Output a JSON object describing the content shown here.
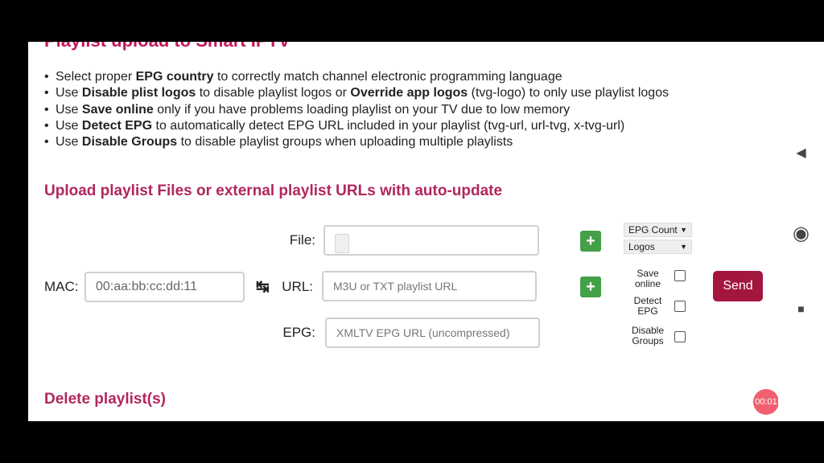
{
  "title": "Playlist upload to Smart IPTV",
  "tips": [
    [
      {
        "t": "Select proper "
      },
      {
        "t": "EPG country",
        "b": true
      },
      {
        "t": " to correctly match channel electronic programming language"
      }
    ],
    [
      {
        "t": "Use "
      },
      {
        "t": "Disable plist logos",
        "b": true
      },
      {
        "t": " to disable playlist logos or "
      },
      {
        "t": "Override app logos",
        "b": true
      },
      {
        "t": " (tvg-logo) to only use playlist logos"
      }
    ],
    [
      {
        "t": "Use "
      },
      {
        "t": "Save online",
        "b": true
      },
      {
        "t": " only if you have problems loading playlist on your TV due to low memory"
      }
    ],
    [
      {
        "t": "Use "
      },
      {
        "t": "Detect EPG",
        "b": true
      },
      {
        "t": " to automatically detect EPG URL included in your playlist (tvg-url, url-tvg, x-tvg-url)"
      }
    ],
    [
      {
        "t": "Use "
      },
      {
        "t": "Disable Groups",
        "b": true
      },
      {
        "t": " to disable playlist groups when uploading multiple playlists"
      }
    ]
  ],
  "upload_title": "Upload playlist Files or external playlist URLs with auto-update",
  "form": {
    "mac_label": "MAC:",
    "mac_value": "00:aa:bb:cc:dd:11",
    "swap_icon": "↹",
    "file_label": "File:",
    "url_label": "URL:",
    "url_placeholder": "M3U or TXT playlist URL",
    "epg_label": "EPG:",
    "epg_placeholder": "XMLTV EPG URL (uncompressed)",
    "plus": "+",
    "selects": {
      "epg_count": "EPG Count",
      "logos": "Logos",
      "arrow": "▼"
    },
    "checks": {
      "save_online": "Save\nonline",
      "detect_epg": "Detect\nEPG",
      "disable_groups": "Disable\nGroups"
    },
    "send": "Send"
  },
  "delete_title": "Delete playlist(s)",
  "recording": "00:01",
  "nav": {
    "back": "◀",
    "home": "◉",
    "recents": "■"
  }
}
